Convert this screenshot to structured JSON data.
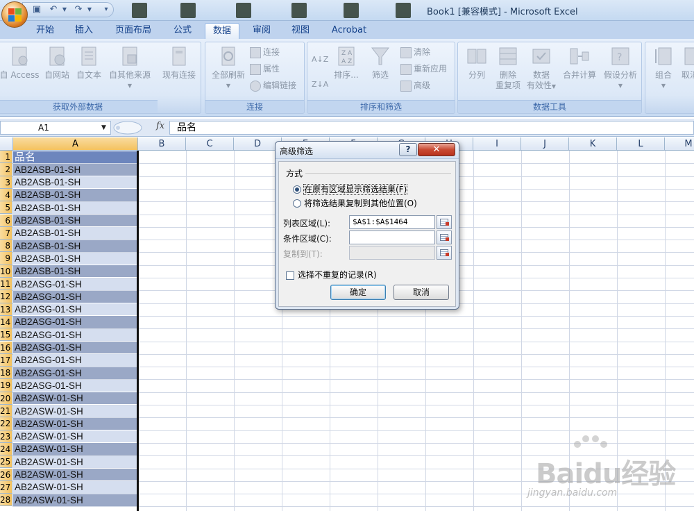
{
  "window": {
    "title": "Book1  [兼容模式] - Microsoft Excel"
  },
  "ribbon_tabs": [
    "开始",
    "插入",
    "页面布局",
    "公式",
    "数据",
    "审阅",
    "视图",
    "Acrobat"
  ],
  "active_tab": "数据",
  "ribbon": {
    "get_external": {
      "label": "获取外部数据",
      "buttons": [
        "自 Access",
        "自网站",
        "自文本",
        "自其他来源"
      ]
    },
    "existing_connections": "现有连接",
    "connections": {
      "label": "连接",
      "refresh_all": "全部刷新",
      "small": [
        "连接",
        "属性",
        "编辑链接"
      ]
    },
    "sort_filter": {
      "label": "排序和筛选",
      "sort": "排序...",
      "filter": "筛选",
      "small": [
        "清除",
        "重新应用",
        "高级"
      ]
    },
    "data_tools": {
      "label": "数据工具",
      "split": "分列",
      "remove_dup_1": "删除",
      "remove_dup_2": "重复项",
      "validation_1": "数据",
      "validation_2": "有效性",
      "consolidate": "合并计算",
      "whatif": "假设分析"
    },
    "outline": {
      "group": "组合",
      "ungroup": "取消"
    }
  },
  "formula_bar": {
    "name_box": "A1",
    "fx": "fx",
    "formula": "品名"
  },
  "columns": [
    "A",
    "B",
    "C",
    "D",
    "E",
    "F",
    "G",
    "H",
    "I",
    "J",
    "K",
    "L",
    "M"
  ],
  "rows": [
    {
      "n": "1",
      "a": "品名"
    },
    {
      "n": "2",
      "a": "AB2ASB-01-SH"
    },
    {
      "n": "3",
      "a": "AB2ASB-01-SH"
    },
    {
      "n": "4",
      "a": "AB2ASB-01-SH"
    },
    {
      "n": "5",
      "a": "AB2ASB-01-SH"
    },
    {
      "n": "6",
      "a": "AB2ASB-01-SH"
    },
    {
      "n": "7",
      "a": "AB2ASB-01-SH"
    },
    {
      "n": "8",
      "a": "AB2ASB-01-SH"
    },
    {
      "n": "9",
      "a": "AB2ASB-01-SH"
    },
    {
      "n": "10",
      "a": "AB2ASB-01-SH"
    },
    {
      "n": "11",
      "a": "AB2ASG-01-SH"
    },
    {
      "n": "12",
      "a": "AB2ASG-01-SH"
    },
    {
      "n": "13",
      "a": "AB2ASG-01-SH"
    },
    {
      "n": "14",
      "a": "AB2ASG-01-SH"
    },
    {
      "n": "15",
      "a": "AB2ASG-01-SH"
    },
    {
      "n": "16",
      "a": "AB2ASG-01-SH"
    },
    {
      "n": "17",
      "a": "AB2ASG-01-SH"
    },
    {
      "n": "18",
      "a": "AB2ASG-01-SH"
    },
    {
      "n": "19",
      "a": "AB2ASG-01-SH"
    },
    {
      "n": "20",
      "a": "AB2ASW-01-SH"
    },
    {
      "n": "21",
      "a": "AB2ASW-01-SH"
    },
    {
      "n": "22",
      "a": "AB2ASW-01-SH"
    },
    {
      "n": "23",
      "a": "AB2ASW-01-SH"
    },
    {
      "n": "24",
      "a": "AB2ASW-01-SH"
    },
    {
      "n": "25",
      "a": "AB2ASW-01-SH"
    },
    {
      "n": "26",
      "a": "AB2ASW-01-SH"
    },
    {
      "n": "27",
      "a": "AB2ASW-01-SH"
    },
    {
      "n": "28",
      "a": "AB2ASW-01-SH"
    }
  ],
  "dialog": {
    "title": "高级筛选",
    "help": "?",
    "close": "✕",
    "section": "方式",
    "radio1": "在原有区域显示筛选结果(F)",
    "radio2": "将筛选结果复制到其他位置(O)",
    "list_range_label": "列表区域(L):",
    "list_range_value": "$A$1:$A$1464",
    "criteria_label": "条件区域(C):",
    "criteria_value": "",
    "copy_to_label": "复制到(T):",
    "copy_to_value": "",
    "unique_label": "选择不重复的记录(R)",
    "ok": "确定",
    "cancel": "取消"
  },
  "watermark": {
    "main": "Baidu经验",
    "url": "jingyan.baidu.com"
  },
  "colors": {
    "header_fill": "#6d86bd",
    "band_dark": "#9aa8c6",
    "band_light": "#d5deef",
    "selected_header": "#f4c25f"
  }
}
